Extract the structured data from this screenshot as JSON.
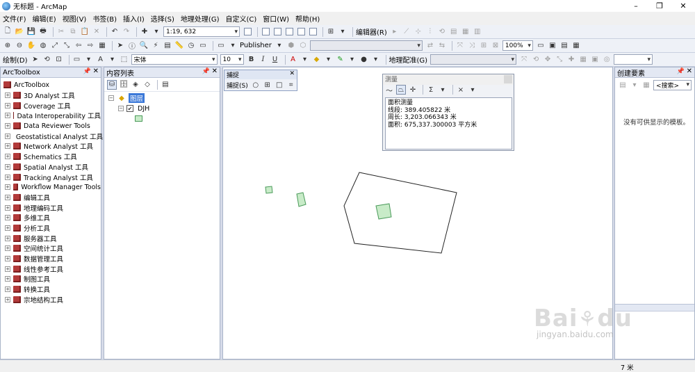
{
  "window": {
    "title": "无标题 - ArcMap",
    "buttons": [
      "–",
      "❐",
      "✕"
    ]
  },
  "menu": [
    "文件(F)",
    "编辑(E)",
    "视图(V)",
    "书签(B)",
    "插入(I)",
    "选择(S)",
    "地理处理(G)",
    "自定义(C)",
    "窗口(W)",
    "帮助(H)"
  ],
  "toolbar1": {
    "scale": "1:19, 632"
  },
  "toolbar2": {
    "publisher": "Publisher",
    "editor": "编辑器(R)",
    "zoom": "100%"
  },
  "toolbar3": {
    "draw": "绘制(D)",
    "font": "宋体",
    "font_size": "10",
    "bold": "B",
    "italic": "I",
    "underline": "U",
    "georef": "地理配准(G)"
  },
  "arctoolbox": {
    "title": "ArcToolbox",
    "root": "ArcToolbox",
    "items": [
      "3D Analyst 工具",
      "Coverage 工具",
      "Data Interoperability 工具",
      "Data Reviewer Tools",
      "Geostatistical Analyst 工具",
      "Network Analyst 工具",
      "Schematics 工具",
      "Spatial Analyst 工具",
      "Tracking Analyst 工具",
      "Workflow Manager Tools",
      "编辑工具",
      "地理编码工具",
      "多维工具",
      "分析工具",
      "服务器工具",
      "空间统计工具",
      "数据管理工具",
      "线性参考工具",
      "制图工具",
      "转换工具",
      "宗地结构工具"
    ]
  },
  "toc": {
    "title": "内容列表",
    "group": "图层",
    "layer": "DJH"
  },
  "snapping": {
    "title": "捕捉",
    "menu": "捕捉(S)"
  },
  "measure": {
    "title": "测量",
    "sigma": "Σ",
    "lines": [
      "面积测量",
      "线段: 389.405822 米",
      "周长: 3,203.066343 米",
      "面积: 675,337.300003 平方米"
    ]
  },
  "create_features": {
    "title": "创建要素",
    "search": "<搜索>",
    "empty": "没有可供显示的模板。"
  },
  "status": {
    "coord": "7 米"
  },
  "colors": {
    "polygon_fill": "#c8ebc8",
    "polygon_stroke": "#4a9a5a",
    "panel_head": "#e3e8f3",
    "toolbox_icon": "#b23a3a"
  },
  "watermark": {
    "logo": "Bai du 经验",
    "url": "jingyan.baidu.com"
  }
}
